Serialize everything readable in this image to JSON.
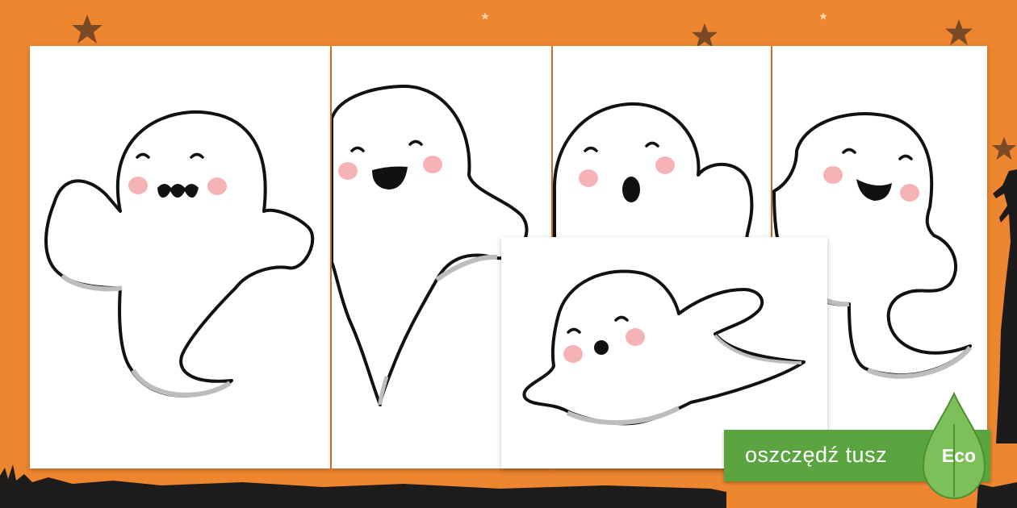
{
  "background": {
    "color": "#ee8630",
    "decorations": [
      "star-icon",
      "grass-silhouette",
      "tree-silhouette"
    ],
    "star_color": "#7a4a26"
  },
  "cards": [
    {
      "name": "ghost-card-1",
      "expression": "smiling-zigzag-mouth"
    },
    {
      "name": "ghost-card-2",
      "expression": "open-smile"
    },
    {
      "name": "ghost-card-3",
      "expression": "surprised-o-mouth"
    },
    {
      "name": "ghost-card-4",
      "expression": "sideways-smile"
    },
    {
      "name": "ghost-card-5",
      "expression": "flying-small-o-mouth"
    }
  ],
  "colors": {
    "outline": "#111111",
    "cheek": "#f6b3b6",
    "card": "#ffffff",
    "eco_green": "#5aa540"
  },
  "eco": {
    "label": "oszczędź tusz",
    "badge": "Eco"
  }
}
